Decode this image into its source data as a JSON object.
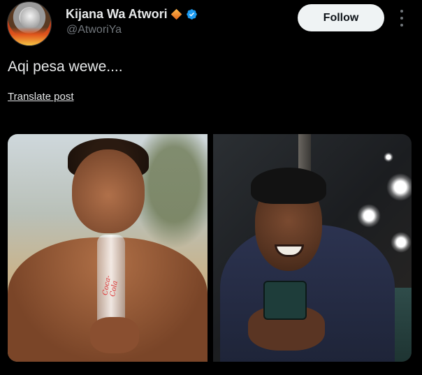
{
  "post": {
    "author": {
      "display_name": "Kijana Wa Atwori",
      "handle": "@AtworiYa",
      "badge_icon": "orange-diamond-icon",
      "verified_icon": "verified-check-icon",
      "verified_color": "#1d9bf0"
    },
    "follow_label": "Follow",
    "more_icon": "more-vertical-icon",
    "text": "Aqi pesa wewe....",
    "translate_label": "Translate post",
    "media": {
      "left_image_text": "Coca-Cola"
    }
  },
  "theme": {
    "background": "#000000",
    "text": "#e7e9ea",
    "muted": "#71767b",
    "button_bg": "#eff3f4"
  }
}
